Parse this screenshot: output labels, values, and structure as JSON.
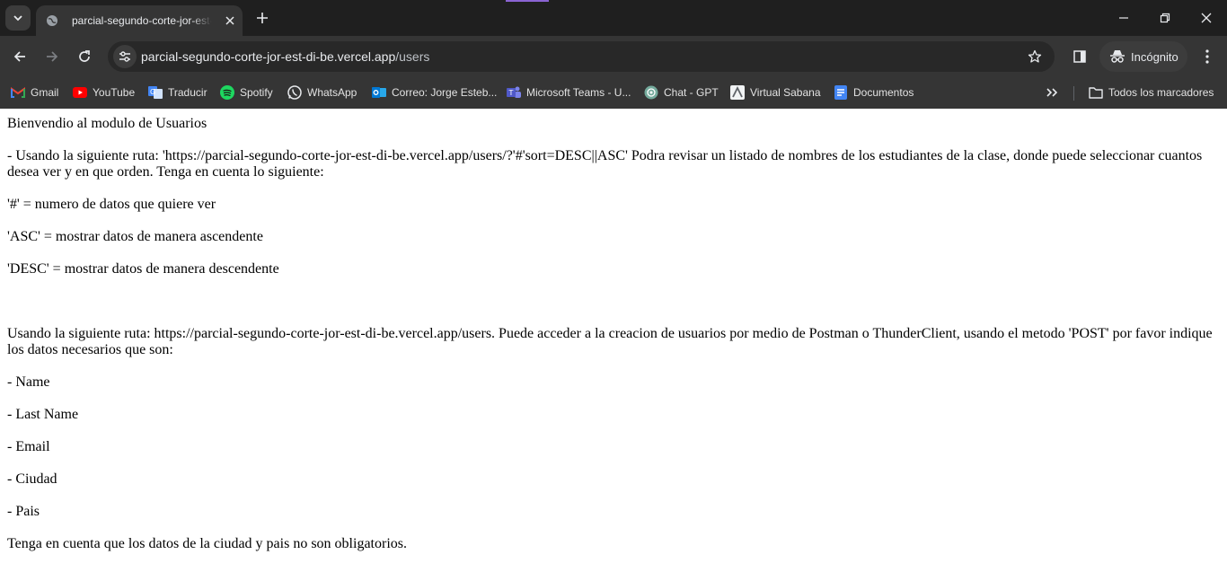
{
  "browser": {
    "tab": {
      "title": "parcial-segundo-corte-jor-est-di-be.vercel.app/users"
    },
    "address": {
      "host": "parcial-segundo-corte-jor-est-di-be.vercel.app",
      "path": "/users"
    },
    "profile_label": "Incógnito",
    "bookmarks": [
      {
        "label": "Gmail",
        "icon": "gmail-icon"
      },
      {
        "label": "YouTube",
        "icon": "youtube-icon"
      },
      {
        "label": "Traducir",
        "icon": "translate-icon"
      },
      {
        "label": "Spotify",
        "icon": "spotify-icon"
      },
      {
        "label": "WhatsApp",
        "icon": "whatsapp-icon"
      },
      {
        "label": "Correo: Jorge Esteb...",
        "icon": "outlook-icon"
      },
      {
        "label": "Microsoft Teams - U...",
        "icon": "teams-icon"
      },
      {
        "label": "Chat - GPT",
        "icon": "chatgpt-icon"
      },
      {
        "label": "Virtual Sabana",
        "icon": "virtual-sabana-icon"
      },
      {
        "label": "Documentos",
        "icon": "docs-icon"
      }
    ],
    "all_bookmarks_label": "Todos los marcadores"
  },
  "page": {
    "welcome": "Bienvendio al modulo de Usuarios",
    "route_list_text": "- Usando la siguiente ruta: 'https://parcial-segundo-corte-jor-est-di-be.vercel.app/users/?'#'sort=DESC||ASC' Podra revisar un listado de nombres de los estudiantes de la clase, donde puede seleccionar cuantos desea ver y en que orden. Tenga en cuenta lo siguiente:",
    "notes": [
      "'#' = numero de datos que quiere ver",
      "'ASC' = mostrar datos de manera ascendente",
      "'DESC' = mostrar datos de manera descendente"
    ],
    "route_post_text": "Usando la siguiente ruta: https://parcial-segundo-corte-jor-est-di-be.vercel.app/users. Puede acceder a la creacion de usuarios por medio de Postman o ThunderClient, usando el metodo 'POST' por favor indique los datos necesarios que son:",
    "fields": [
      "- Name",
      "- Last Name",
      "- Email",
      "- Ciudad",
      "- Pais"
    ],
    "footer_note": "Tenga en cuenta que los datos de la ciudad y pais no son obligatorios."
  },
  "colors": {
    "chrome_bg": "#202124",
    "toolbar_bg": "#353535",
    "omnibox_bg": "#282828",
    "text_light": "#e8eaed"
  }
}
